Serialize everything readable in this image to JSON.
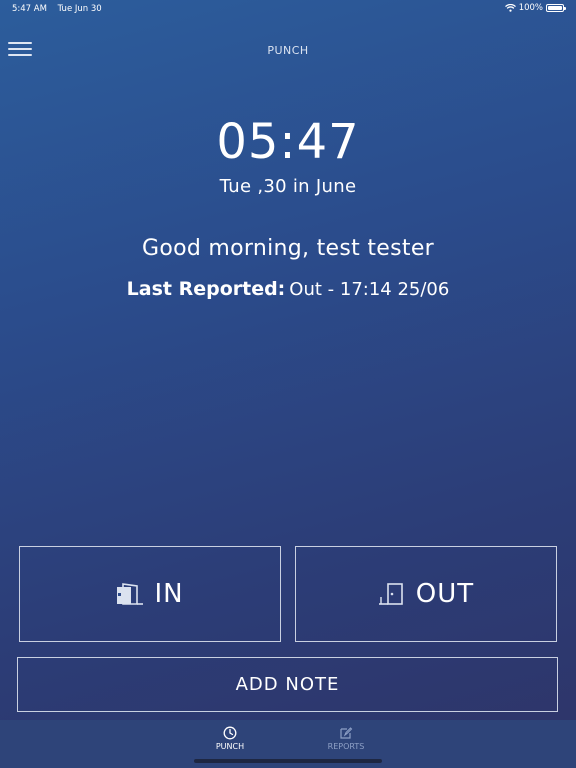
{
  "status_bar": {
    "time": "5:47 AM",
    "date": "Tue Jun 30",
    "battery_percent": "100%",
    "battery_level": 1.0
  },
  "nav": {
    "title": "PUNCH",
    "menu_icon": "hamburger-menu-icon"
  },
  "clock": {
    "time": "05:47",
    "date": "Tue ,30 in June"
  },
  "greeting": "Good morning, test  tester",
  "last_reported": {
    "label": "Last Reported:",
    "value": "Out - 17:14 25/06"
  },
  "actions": {
    "in_label": "IN",
    "in_icon": "door-in-icon",
    "out_label": "OUT",
    "out_icon": "door-out-icon",
    "note_label": "ADD NOTE"
  },
  "tabs": [
    {
      "label": "PUNCH",
      "icon": "clock-icon",
      "active": true
    },
    {
      "label": "REPORTS",
      "icon": "edit-report-icon",
      "active": false
    }
  ],
  "colors": {
    "background_top": "#2c5d9c",
    "background_bottom": "#2e3468",
    "tab_bar": "#2e4479",
    "inactive_tab": "#8ea0c6"
  }
}
